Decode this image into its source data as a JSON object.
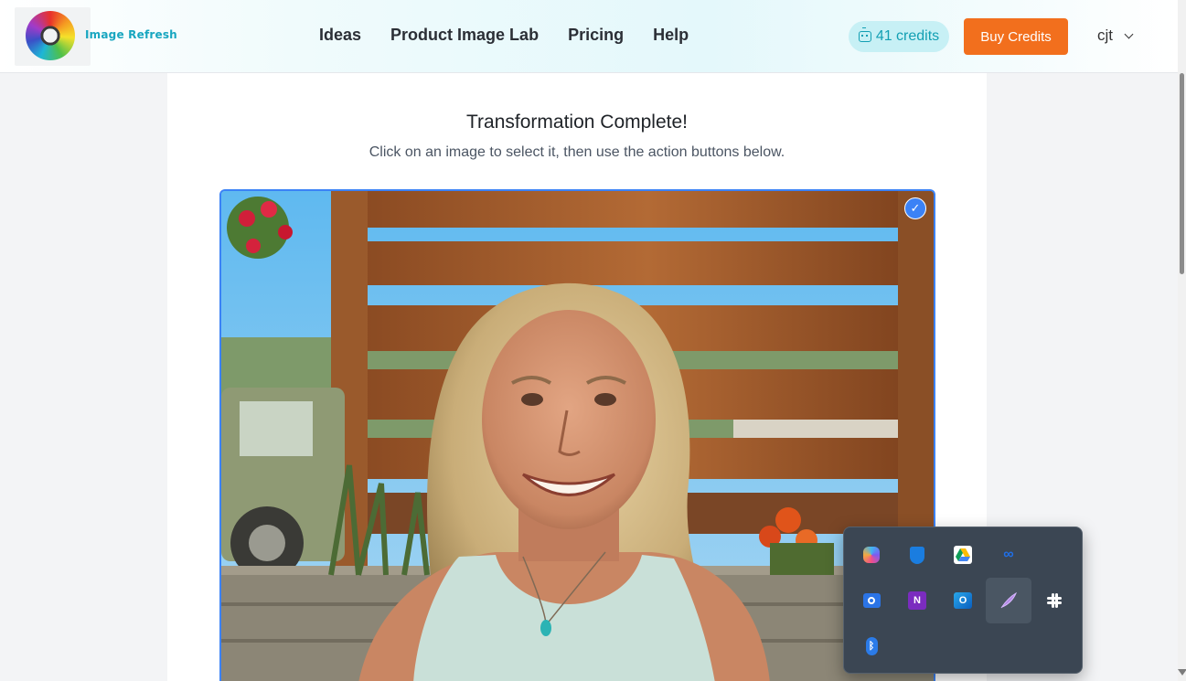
{
  "header": {
    "logo_text": "Image Refresh",
    "nav": [
      "Ideas",
      "Product Image Lab",
      "Pricing",
      "Help"
    ],
    "credits": "41 credits",
    "buy_label": "Buy Credits",
    "user_name": "cjt"
  },
  "main": {
    "title": "Transformation Complete!",
    "subtitle": "Click on an image to select it, then use the action buttons below."
  },
  "tray": {
    "icons": [
      "copilot-icon",
      "defender-shield-icon",
      "google-drive-icon",
      "meta-icon",
      "focus-todo-icon",
      "camera-app-icon",
      "onenote-icon",
      "outlook-icon",
      "quill-feather-icon",
      "slack-icon",
      "bluetooth-icon"
    ],
    "active_icon": "quill-feather-icon"
  },
  "colors": {
    "accent_orange": "#f26f1d",
    "credits_teal": "#129fb3",
    "selection_blue": "#3b82f6"
  }
}
